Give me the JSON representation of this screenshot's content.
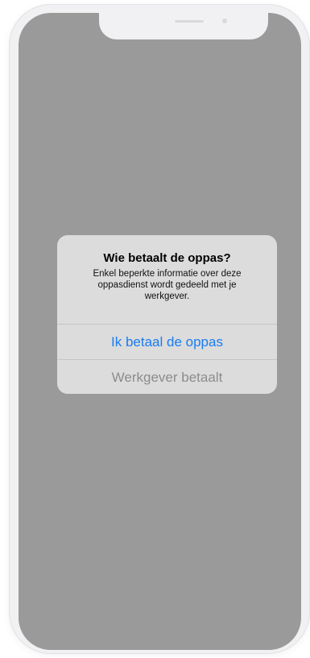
{
  "alert": {
    "title": "Wie betaalt de oppas?",
    "message": "Enkel beperkte informatie over deze oppasdienst wordt gedeeld met je werkgever.",
    "primary_button": "Ik betaal de oppas",
    "secondary_button": "Werkgever betaalt",
    "colors": {
      "primary": "#1a7cf0",
      "secondary": "#8c8c8c",
      "alert_background": "#dcdcdc",
      "screen_overlay": "#9a9a9a"
    }
  }
}
